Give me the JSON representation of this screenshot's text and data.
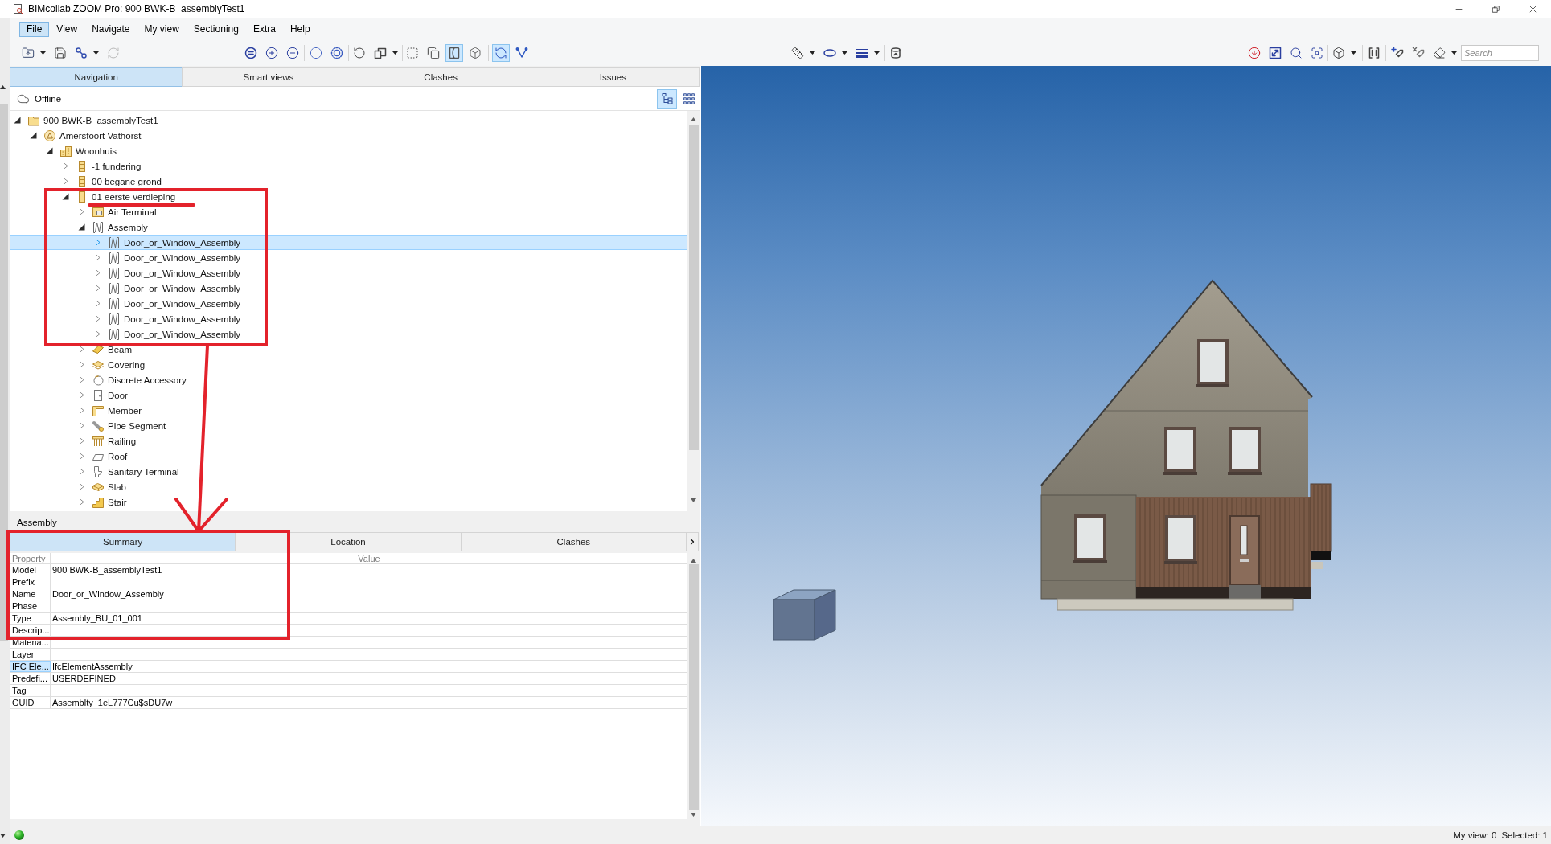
{
  "window": {
    "title": "BIMcollab ZOOM Pro: 900 BWK-B_assemblyTest1"
  },
  "menu": [
    {
      "label": "File",
      "selected": true
    },
    {
      "label": "View",
      "selected": false
    },
    {
      "label": "Navigate",
      "selected": false
    },
    {
      "label": "My view",
      "selected": false
    },
    {
      "label": "Sectioning",
      "selected": false
    },
    {
      "label": "Extra",
      "selected": false
    },
    {
      "label": "Help",
      "selected": false
    }
  ],
  "toolbar": {
    "groups": [
      [
        {
          "kind": "open",
          "dropdown": true,
          "pressed": false,
          "disabled": false
        },
        {
          "kind": "save",
          "dropdown": false,
          "pressed": false,
          "disabled": false
        },
        {
          "kind": "link",
          "dropdown": true,
          "pressed": false,
          "disabled": false
        },
        {
          "kind": "refresh",
          "dropdown": false,
          "pressed": false,
          "disabled": true
        }
      ],
      [
        {
          "kind": "fit",
          "dropdown": false,
          "pressed": false,
          "disabled": false
        },
        {
          "kind": "zoomin",
          "dropdown": false,
          "pressed": false,
          "disabled": false
        },
        {
          "kind": "zoomout",
          "dropdown": false,
          "pressed": false,
          "disabled": false
        }
      ],
      [
        {
          "kind": "select",
          "dropdown": false,
          "pressed": false,
          "disabled": false
        },
        {
          "kind": "selectring",
          "dropdown": false,
          "pressed": false,
          "disabled": false
        }
      ],
      [
        {
          "kind": "rotate",
          "dropdown": false,
          "pressed": false,
          "disabled": false
        },
        {
          "kind": "views",
          "dropdown": true,
          "pressed": false,
          "disabled": false
        }
      ],
      [
        {
          "kind": "clip",
          "dropdown": false,
          "pressed": false,
          "disabled": false
        },
        {
          "kind": "copy",
          "dropdown": false,
          "pressed": false,
          "disabled": false
        },
        {
          "kind": "panel",
          "dropdown": false,
          "pressed": true,
          "disabled": false
        },
        {
          "kind": "cube",
          "dropdown": false,
          "pressed": false,
          "disabled": false
        }
      ],
      [
        {
          "kind": "sync",
          "dropdown": false,
          "pressed": true,
          "disabled": false
        },
        {
          "kind": "filter",
          "dropdown": false,
          "pressed": false,
          "disabled": false
        }
      ],
      [
        {
          "kind": "measure",
          "dropdown": true,
          "pressed": false,
          "disabled": false
        },
        {
          "kind": "ellipse",
          "dropdown": true,
          "pressed": false,
          "disabled": false
        },
        {
          "kind": "lines",
          "dropdown": true,
          "pressed": false,
          "disabled": false
        }
      ],
      [
        {
          "kind": "snapshot",
          "dropdown": false,
          "pressed": false,
          "disabled": false
        }
      ],
      [
        {
          "kind": "alert",
          "dropdown": false,
          "pressed": false,
          "disabled": false
        },
        {
          "kind": "expand",
          "dropdown": false,
          "pressed": false,
          "disabled": false
        },
        {
          "kind": "zoom",
          "dropdown": false,
          "pressed": false,
          "disabled": false
        },
        {
          "kind": "zoombox",
          "dropdown": false,
          "pressed": false,
          "disabled": false
        }
      ],
      [
        {
          "kind": "boxview",
          "dropdown": true,
          "pressed": false,
          "disabled": false
        }
      ],
      [
        {
          "kind": "frame",
          "dropdown": false,
          "pressed": false,
          "disabled": false
        }
      ],
      [
        {
          "kind": "tagadd",
          "dropdown": false,
          "pressed": false,
          "disabled": false
        },
        {
          "kind": "tagremove",
          "dropdown": false,
          "pressed": false,
          "disabled": false
        },
        {
          "kind": "erase",
          "dropdown": true,
          "pressed": false,
          "disabled": false
        }
      ]
    ],
    "search": {
      "placeholder": "Search"
    }
  },
  "panel_tabs": [
    {
      "label": "Navigation",
      "selected": true
    },
    {
      "label": "Smart views",
      "selected": false
    },
    {
      "label": "Clashes",
      "selected": false
    },
    {
      "label": "Issues",
      "selected": false
    }
  ],
  "connection": {
    "label": "Offline"
  },
  "view_modes": [
    {
      "kind": "tree",
      "selected": true
    },
    {
      "kind": "grid",
      "selected": false
    }
  ],
  "tree": [
    {
      "label": "900 BWK-B_assemblyTest1",
      "kind": "folder",
      "expanded": true,
      "selected": false,
      "children": [
        {
          "label": "Amersfoort Vathorst",
          "kind": "site",
          "expanded": true,
          "selected": false,
          "children": [
            {
              "label": "Woonhuis",
              "kind": "building",
              "expanded": true,
              "selected": false,
              "children": [
                {
                  "label": "-1 fundering",
                  "kind": "storey",
                  "expanded": false,
                  "selected": false
                },
                {
                  "label": "00 begane grond",
                  "kind": "storey",
                  "expanded": false,
                  "selected": false
                },
                {
                  "label": "01 eerste verdieping",
                  "kind": "storey",
                  "expanded": true,
                  "selected": false,
                  "children": [
                    {
                      "label": "Air Terminal",
                      "kind": "airterminal",
                      "expanded": false,
                      "selected": false
                    },
                    {
                      "label": "Assembly",
                      "kind": "assembly",
                      "expanded": true,
                      "selected": false,
                      "children": [
                        {
                          "label": "Door_or_Window_Assembly",
                          "kind": "assembly",
                          "expanded": false,
                          "selected": true
                        },
                        {
                          "label": "Door_or_Window_Assembly",
                          "kind": "assembly",
                          "expanded": false,
                          "selected": false
                        },
                        {
                          "label": "Door_or_Window_Assembly",
                          "kind": "assembly",
                          "expanded": false,
                          "selected": false
                        },
                        {
                          "label": "Door_or_Window_Assembly",
                          "kind": "assembly",
                          "expanded": false,
                          "selected": false
                        },
                        {
                          "label": "Door_or_Window_Assembly",
                          "kind": "assembly",
                          "expanded": false,
                          "selected": false
                        },
                        {
                          "label": "Door_or_Window_Assembly",
                          "kind": "assembly",
                          "expanded": false,
                          "selected": false
                        },
                        {
                          "label": "Door_or_Window_Assembly",
                          "kind": "assembly",
                          "expanded": false,
                          "selected": false
                        }
                      ]
                    },
                    {
                      "label": "Beam",
                      "kind": "beam",
                      "expanded": false,
                      "selected": false
                    },
                    {
                      "label": "Covering",
                      "kind": "covering",
                      "expanded": false,
                      "selected": false
                    },
                    {
                      "label": "Discrete Accessory",
                      "kind": "accessory",
                      "expanded": false,
                      "selected": false
                    },
                    {
                      "label": "Door",
                      "kind": "door",
                      "expanded": false,
                      "selected": false
                    },
                    {
                      "label": "Member",
                      "kind": "member",
                      "expanded": false,
                      "selected": false
                    },
                    {
                      "label": "Pipe Segment",
                      "kind": "pipe",
                      "expanded": false,
                      "selected": false
                    },
                    {
                      "label": "Railing",
                      "kind": "railing",
                      "expanded": false,
                      "selected": false
                    },
                    {
                      "label": "Roof",
                      "kind": "roof",
                      "expanded": false,
                      "selected": false
                    },
                    {
                      "label": "Sanitary Terminal",
                      "kind": "sanitary",
                      "expanded": false,
                      "selected": false
                    },
                    {
                      "label": "Slab",
                      "kind": "slab",
                      "expanded": false,
                      "selected": false
                    },
                    {
                      "label": "Stair",
                      "kind": "stair",
                      "expanded": false,
                      "selected": false
                    }
                  ]
                }
              ]
            }
          ]
        }
      ]
    }
  ],
  "properties": {
    "title": "Assembly",
    "tabs": [
      {
        "label": "Summary",
        "selected": true
      },
      {
        "label": "Location",
        "selected": false
      },
      {
        "label": "Clashes",
        "selected": false
      }
    ],
    "columns": [
      "Property",
      "Value"
    ],
    "rows": [
      {
        "property": "Model",
        "value": "900 BWK-B_assemblyTest1",
        "selected": false
      },
      {
        "property": "Prefix",
        "selected": false
      },
      {
        "property": "Name",
        "value": "Door_or_Window_Assembly",
        "selected": false
      },
      {
        "property": "Phase",
        "selected": false
      },
      {
        "property": "Type",
        "value": "Assembly_BU_01_001",
        "selected": false
      },
      {
        "property": "Descrip...",
        "selected": false
      },
      {
        "property": "Materia...",
        "selected": false
      },
      {
        "property": "Layer",
        "selected": false
      },
      {
        "property": "IFC Ele...",
        "value": "IfcElementAssembly",
        "selected": true
      },
      {
        "property": "Predefi...",
        "value": "USERDEFINED",
        "selected": false
      },
      {
        "property": "Tag",
        "selected": false
      },
      {
        "property": "GUID",
        "value": "Assemblty_1eL777Cu$sDU7w",
        "selected": false
      }
    ]
  },
  "status_bar": {
    "texts": [
      "My view: 0",
      "Selected: 1"
    ]
  },
  "annotations": [
    {
      "kind": "rectangle"
    },
    {
      "kind": "underline"
    },
    {
      "kind": "arrow"
    },
    {
      "kind": "rectangle"
    }
  ]
}
